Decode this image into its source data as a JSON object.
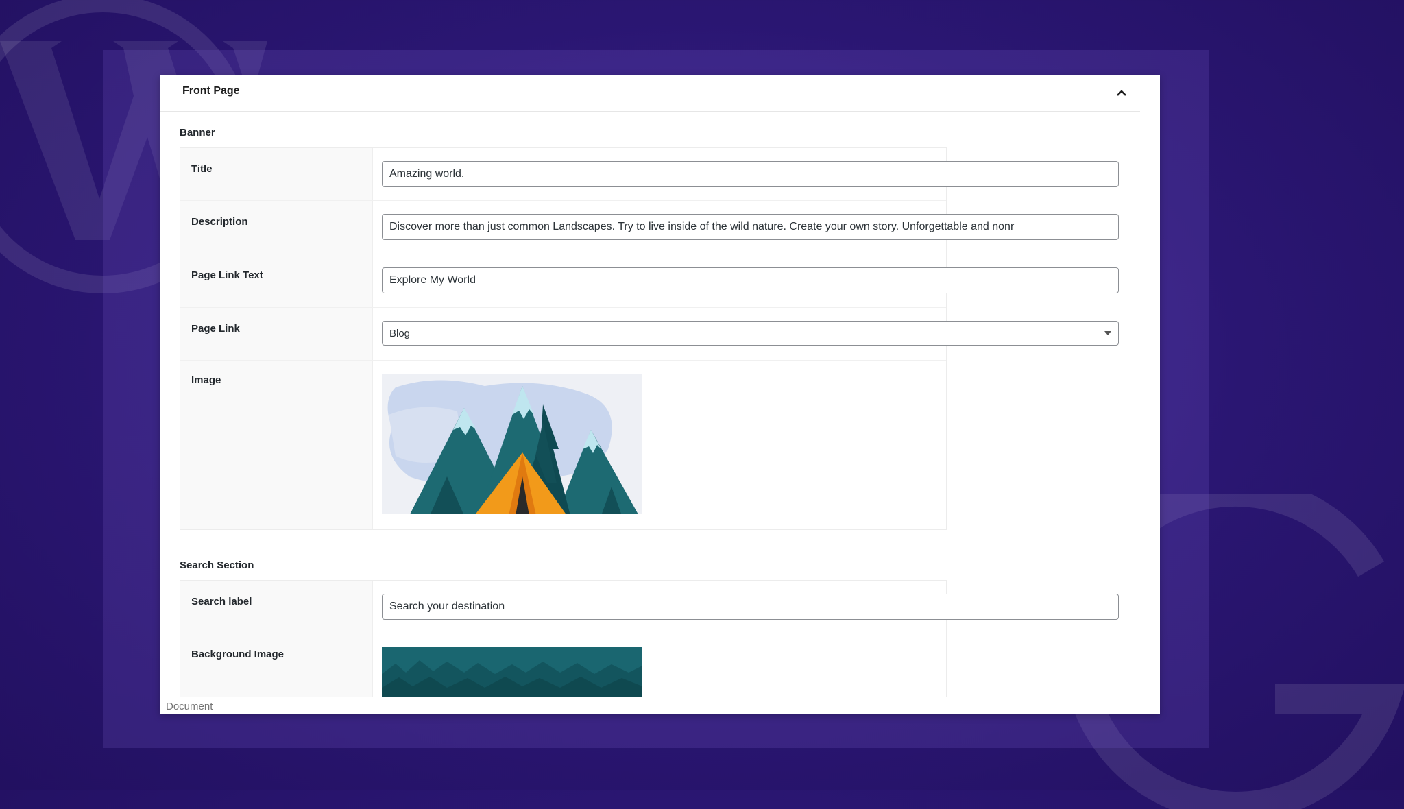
{
  "panel": {
    "title": "Front Page"
  },
  "banner": {
    "section_label": "Banner",
    "fields": [
      {
        "label": "Title",
        "value": "Amazing world."
      },
      {
        "label": "Description",
        "value": "Discover more than just common Landscapes. Try to live inside of the wild nature. Create your own story. Unforgettable and nonr"
      },
      {
        "label": "Page Link Text",
        "value": "Explore My World"
      },
      {
        "label": "Page Link",
        "selected": "Blog"
      },
      {
        "label": "Image"
      }
    ]
  },
  "search_section": {
    "section_label": "Search Section",
    "fields": [
      {
        "label": "Search label",
        "value": "Search your destination"
      },
      {
        "label": "Background Image"
      }
    ]
  },
  "status_bar": {
    "text": "Document"
  },
  "colors": {
    "background": "#2a1672",
    "mountain_teal": "#1d6a72",
    "mountain_dark": "#0f4a52",
    "snow": "#bfe6ef",
    "tent_orange": "#f29a1a",
    "sky_wash": "#c9d6ee"
  }
}
